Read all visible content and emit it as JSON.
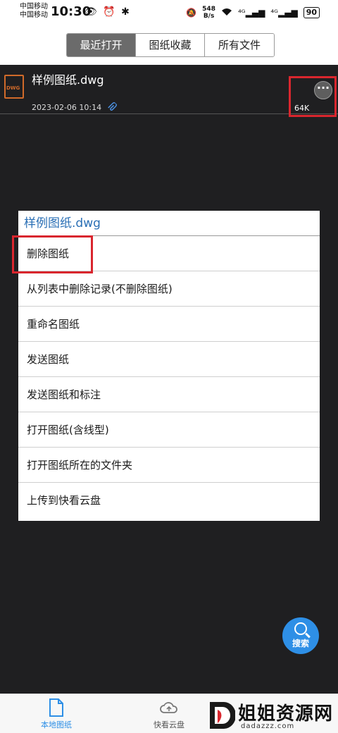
{
  "status_bar": {
    "carrier_1": "中国移动",
    "carrier_2": "中国移动",
    "time": "10:30",
    "left_icons": "👁 ⏰ ✱",
    "mute_icon": "🔕",
    "net_speed_value": "548",
    "net_speed_unit": "B/s",
    "signal_1": "⁴ᴳ▂▄▆",
    "signal_2": "⁴ᴳ▂▄▆",
    "battery": "90"
  },
  "tabs": {
    "recent": "最近打开",
    "favorites": "图纸收藏",
    "all_files": "所有文件",
    "active": "recent"
  },
  "file": {
    "icon_label": "DWG",
    "name": "样例图纸.dwg",
    "date": "2023-02-06 10:14",
    "size": "64K"
  },
  "menu": {
    "title": "样例图纸.dwg",
    "items": [
      "删除图纸",
      "从列表中删除记录(不删除图纸)",
      "重命名图纸",
      "发送图纸",
      "发送图纸和标注",
      "打开图纸(含线型)",
      "打开图纸所在的文件夹",
      "上传到快看云盘"
    ]
  },
  "search_fab": {
    "label": "搜索"
  },
  "bottom_nav": {
    "local": "本地图纸",
    "cloud": "快看云盘"
  },
  "watermark": {
    "text": "姐姐资源网",
    "url": "dadazzz.com"
  },
  "colors": {
    "accent_blue": "#2e8fe6",
    "highlight_red": "#d9262e",
    "dwg_orange": "#d06a2a",
    "menu_title_blue": "#2a6fb5"
  }
}
